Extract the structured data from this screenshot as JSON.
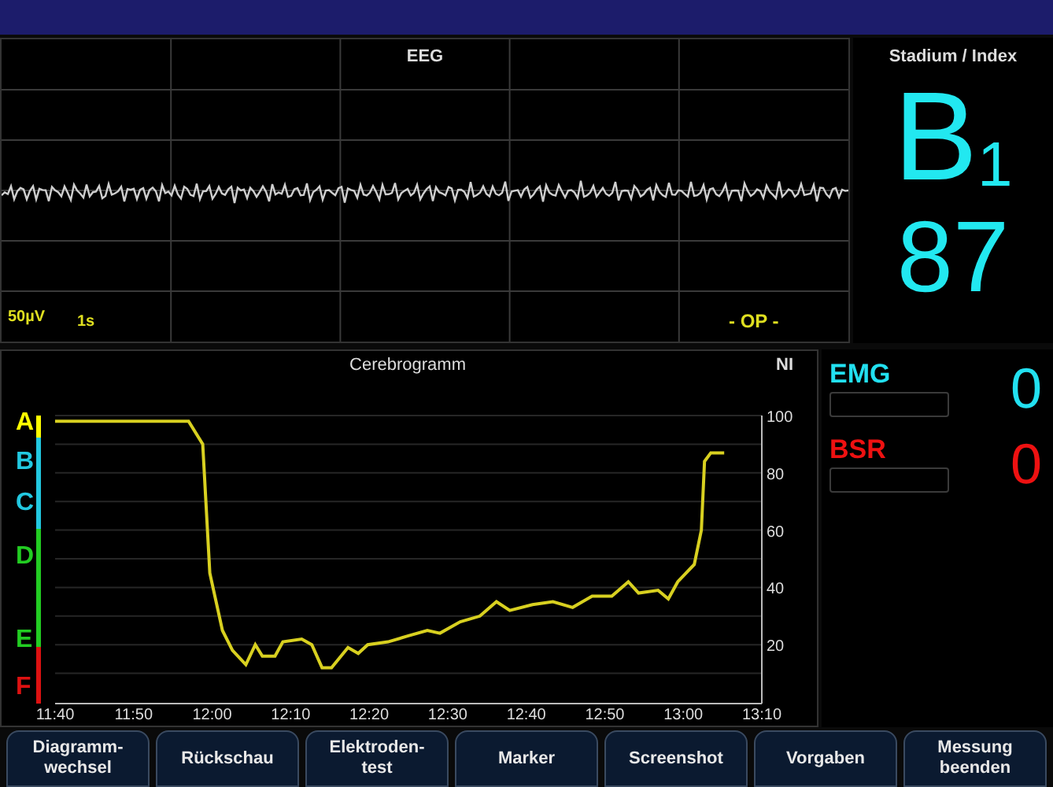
{
  "eeg": {
    "title": "EEG",
    "scale": "50µV",
    "timebase": "1s",
    "mode": "- OP -"
  },
  "stadium": {
    "title": "Stadium / Index",
    "stage": "B$_{1}$",
    "index": "87"
  },
  "cerebrogramm": {
    "stages": [
      {
        "label": "A",
        "color": "#ffff00"
      },
      {
        "label": "B",
        "color": "#22c8e0"
      },
      {
        "label": "C",
        "color": "#22c8e0"
      },
      {
        "label": "D",
        "color": "#22cc22"
      },
      {
        "label": "E",
        "color": "#22cc22"
      },
      {
        "label": "F",
        "color": "#dd1111"
      }
    ],
    "chart_data": {
      "type": "line",
      "title": "Cerebrogramm",
      "ylabel": "NI",
      "x": [
        700,
        717,
        718.8,
        719.7,
        721.3,
        722.6,
        724.3,
        725.5,
        726.4,
        728,
        729,
        731.4,
        732.7,
        734,
        735.2,
        737.3,
        738.6,
        739.8,
        742.4,
        744.9,
        747.4,
        749,
        751.6,
        754.1,
        756.2,
        757.9,
        760.8,
        763.4,
        765.9,
        768.4,
        770.9,
        773,
        774.3,
        776.8,
        778.1,
        779.3,
        781.4,
        782.3,
        782.7,
        783.5,
        785.2
      ],
      "series": [
        {
          "color": "#d8d020",
          "values": [
            98,
            98,
            90,
            45,
            25,
            18,
            13,
            20,
            16,
            16,
            21,
            22,
            20,
            12,
            12,
            19,
            17,
            20,
            21,
            23,
            25,
            24,
            28,
            30,
            35,
            32,
            34,
            35,
            33,
            37,
            37,
            42,
            38,
            39,
            36,
            42,
            48,
            60,
            84,
            87,
            87
          ]
        }
      ],
      "xlim": [
        700,
        790
      ],
      "ylim": [
        0,
        100
      ],
      "grid": true,
      "xticks": [
        {
          "value": 700,
          "label": "11:40"
        },
        {
          "value": 710,
          "label": "11:50"
        },
        {
          "value": 720,
          "label": "12:00"
        },
        {
          "value": 730,
          "label": "12:10"
        },
        {
          "value": 740,
          "label": "12:20"
        },
        {
          "value": 750,
          "label": "12:30"
        },
        {
          "value": 760,
          "label": "12:40"
        },
        {
          "value": 770,
          "label": "12:50"
        },
        {
          "value": 780,
          "label": "13:00"
        },
        {
          "value": 790,
          "label": "13:10"
        }
      ],
      "yticks": [
        20,
        40,
        60,
        80,
        100
      ]
    }
  },
  "meters": [
    {
      "label": "EMG",
      "value": "0",
      "color": "#22e0f0",
      "level": 0
    },
    {
      "label": "BSR",
      "value": "0",
      "color": "#ee1111",
      "level": 0
    }
  ],
  "buttons": [
    {
      "lines": [
        "Diagramm-",
        "wechsel"
      ]
    },
    {
      "lines": [
        "Rückschau"
      ]
    },
    {
      "lines": [
        "Elektroden-",
        "test"
      ]
    },
    {
      "lines": [
        "Marker"
      ]
    },
    {
      "lines": [
        "Screenshot"
      ]
    },
    {
      "lines": [
        "Vorgaben"
      ]
    },
    {
      "lines": [
        "Messung",
        "beenden"
      ]
    }
  ]
}
